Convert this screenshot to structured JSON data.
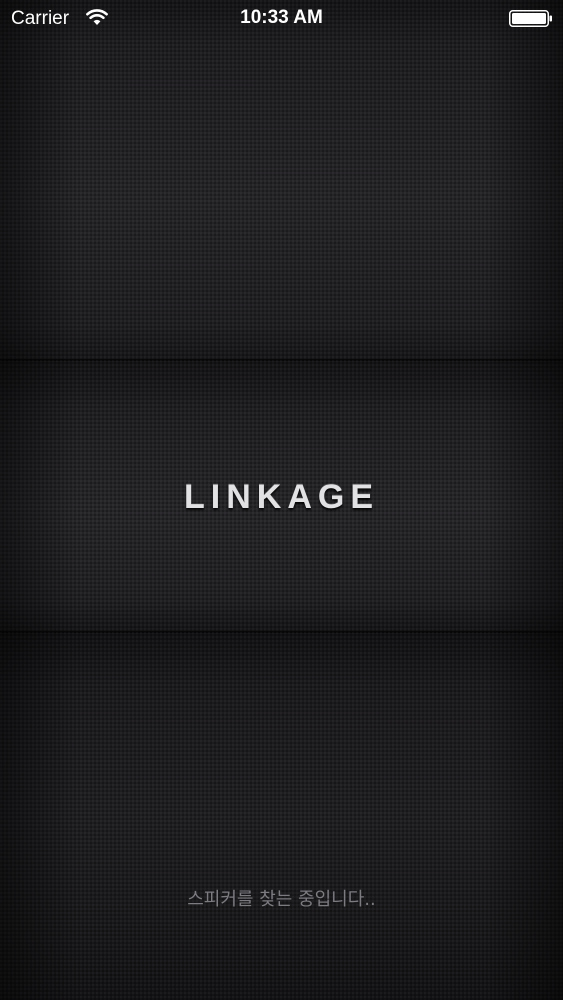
{
  "status_bar": {
    "carrier": "Carrier",
    "time": "10:33 AM",
    "icons": [
      "wifi-icon",
      "battery-icon"
    ]
  },
  "splash": {
    "logo_text": "LINKAGE",
    "status_text": "스피커를 찾는 중입니다.."
  },
  "colors": {
    "background": "#1a191b",
    "logo_text": "#e2e2e4",
    "status_text": "#7c7b80"
  }
}
